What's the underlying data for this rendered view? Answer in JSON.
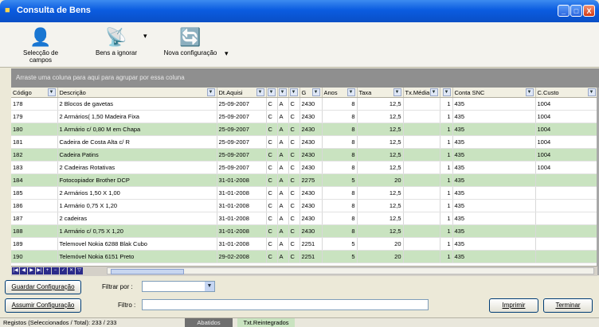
{
  "window": {
    "title": "Consulta de Bens",
    "controls": [
      "_",
      "□",
      "X"
    ]
  },
  "toolbar": {
    "items": [
      {
        "label": "Selecção de campos",
        "icon": "person-fields-icon",
        "glyph": "👤"
      },
      {
        "label": "Bens a ignorar",
        "icon": "satellite-dish-icon",
        "glyph": "📡"
      },
      {
        "label": "Nova configuração",
        "icon": "refresh-icon",
        "glyph": "🔄"
      }
    ],
    "drop_glyph": "▾"
  },
  "group_area": {
    "text": "Arraste uma coluna para aqui para agrupar por essa coluna"
  },
  "grid": {
    "columns": [
      "Código",
      "Descrição",
      "Dt.Aquisi",
      "",
      "",
      "",
      "G",
      "Anos",
      "Taxa",
      "Tx.Média",
      "",
      "Conta SNC",
      "C.Custo"
    ],
    "rows": [
      [
        "178",
        "2 Blocos de gavetas",
        "25-09-2007",
        "C",
        "A",
        "C",
        "2430",
        "8",
        "12,5",
        "",
        "1",
        "435",
        "1004"
      ],
      [
        "179",
        "2 Armários( 1,50 Madeira Fixa",
        "25-09-2007",
        "C",
        "A",
        "C",
        "2430",
        "8",
        "12,5",
        "",
        "1",
        "435",
        "1004"
      ],
      [
        "180",
        "1 Armário c/ 0,80 M em Chapa",
        "25-09-2007",
        "C",
        "A",
        "C",
        "2430",
        "8",
        "12,5",
        "",
        "1",
        "435",
        "1004"
      ],
      [
        "181",
        "Cadeira de Costa Alta c/ R",
        "25-09-2007",
        "C",
        "A",
        "C",
        "2430",
        "8",
        "12,5",
        "",
        "1",
        "435",
        "1004"
      ],
      [
        "182",
        "Cadeira Patins",
        "25-09-2007",
        "C",
        "A",
        "C",
        "2430",
        "8",
        "12,5",
        "",
        "1",
        "435",
        "1004"
      ],
      [
        "183",
        "2 Cadeiras Rotativas",
        "25-09-2007",
        "C",
        "A",
        "C",
        "2430",
        "8",
        "12,5",
        "",
        "1",
        "435",
        "1004"
      ],
      [
        "184",
        "Fotocopiador Brother DCP",
        "31-01-2008",
        "C",
        "A",
        "C",
        "2275",
        "5",
        "20",
        "",
        "1",
        "435",
        ""
      ],
      [
        "185",
        "2 Armários 1,50 X 1,00",
        "31-01-2008",
        "C",
        "A",
        "C",
        "2430",
        "8",
        "12,5",
        "",
        "1",
        "435",
        ""
      ],
      [
        "186",
        "1 Armário 0,75 X 1,20",
        "31-01-2008",
        "C",
        "A",
        "C",
        "2430",
        "8",
        "12,5",
        "",
        "1",
        "435",
        ""
      ],
      [
        "187",
        "2 cadeiras",
        "31-01-2008",
        "C",
        "A",
        "C",
        "2430",
        "8",
        "12,5",
        "",
        "1",
        "435",
        ""
      ],
      [
        "188",
        "1 Armário c/ 0,75 X 1,20",
        "31-01-2008",
        "C",
        "A",
        "C",
        "2430",
        "8",
        "12,5",
        "",
        "1",
        "435",
        ""
      ],
      [
        "189",
        "Telemovel Nokia 6288 Blak Cubo",
        "31-01-2008",
        "C",
        "A",
        "C",
        "2251",
        "5",
        "20",
        "",
        "1",
        "435",
        ""
      ],
      [
        "190",
        "Telemóvel Nokia 6151 Preto",
        "29-02-2008",
        "C",
        "A",
        "C",
        "2251",
        "5",
        "20",
        "",
        "1",
        "435",
        ""
      ]
    ]
  },
  "navigator": {
    "buttons": [
      "|◀",
      "◀",
      "▶",
      "▶|",
      "+",
      "−",
      "✓",
      "✕",
      "▽"
    ]
  },
  "bottom": {
    "save_config": "Guardar Configuração",
    "filter_by_label": "Filtrar por :",
    "filter_by_value": "",
    "assume_config": "Assumir Configuração",
    "filter_label": "Filtro :",
    "filter_value": "",
    "print": "Imprimir",
    "finish": "Terminar"
  },
  "status": {
    "text": "Registos (Seleccionados / Total): 233 / 233",
    "tab1": "Abatidos",
    "tab2": "Txt.Reintegrados"
  },
  "colors": {
    "alt_row": "#c9e3c0",
    "titlebar": "#0b5ce0"
  }
}
